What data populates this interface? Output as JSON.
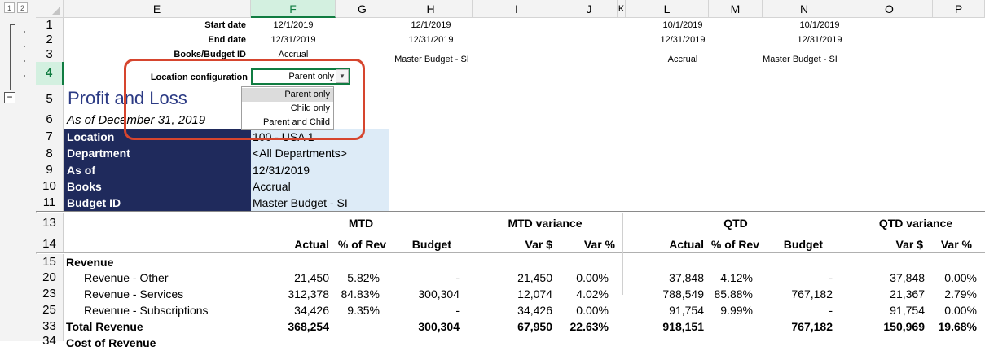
{
  "outline": {
    "level1": "1",
    "level2": "2",
    "collapse": "−"
  },
  "columns": [
    "E",
    "F",
    "G",
    "H",
    "I",
    "J",
    "K",
    "L",
    "M",
    "N",
    "O",
    "P"
  ],
  "rows": [
    "1",
    "2",
    "3",
    "4",
    "5",
    "6",
    "7",
    "8",
    "9",
    "10",
    "11",
    "13",
    "14",
    "15",
    "20",
    "23",
    "25",
    "33",
    "34"
  ],
  "params": {
    "start_label": "Start date",
    "end_label": "End date",
    "books_label": "Books/Budget ID",
    "locconf_label": "Location configuration",
    "f1": "12/1/2019",
    "h1": "12/1/2019",
    "l1": "10/1/2019",
    "n1": "10/1/2019",
    "f2": "12/31/2019",
    "h2": "12/31/2019",
    "l2": "12/31/2019",
    "n2": "12/31/2019",
    "f3": "Accrual",
    "h3": "Master Budget - SI",
    "l3": "Accrual",
    "n3": "Master Budget - SI"
  },
  "dropdown": {
    "value": "Parent only",
    "arrow": "▼",
    "options": [
      "Parent only",
      "Child only",
      "Parent and Child"
    ]
  },
  "report": {
    "title": "Profit and Loss",
    "subtitle": "As of December 31, 2019",
    "filters": [
      {
        "label": "Location",
        "value": "100 - USA 1"
      },
      {
        "label": "Department",
        "value": "<All Departments>"
      },
      {
        "label": "As of",
        "value": "12/31/2019"
      },
      {
        "label": "Books",
        "value": "Accrual"
      },
      {
        "label": "Budget ID",
        "value": "Master Budget - SI"
      }
    ]
  },
  "headers": {
    "mtd": "MTD",
    "mtd_var": "MTD variance",
    "qtd": "QTD",
    "qtd_var": "QTD variance",
    "actual": "Actual",
    "pct_rev": "% of Rev",
    "budget": "Budget",
    "var_d": "Var $",
    "var_p": "Var %"
  },
  "lines": [
    {
      "label": "Revenue",
      "indent": false,
      "bold": true,
      "vals": [
        "",
        "",
        "",
        "",
        "",
        "",
        "",
        "",
        "",
        ""
      ]
    },
    {
      "label": "Revenue - Other",
      "indent": true,
      "bold": false,
      "vals": [
        "21,450",
        "5.82%",
        "-",
        "21,450",
        "0.00%",
        "37,848",
        "4.12%",
        "-",
        "37,848",
        "0.00%"
      ]
    },
    {
      "label": "Revenue - Services",
      "indent": true,
      "bold": false,
      "vals": [
        "312,378",
        "84.83%",
        "300,304",
        "12,074",
        "4.02%",
        "788,549",
        "85.88%",
        "767,182",
        "21,367",
        "2.79%"
      ]
    },
    {
      "label": "Revenue - Subscriptions",
      "indent": true,
      "bold": false,
      "vals": [
        "34,426",
        "9.35%",
        "-",
        "34,426",
        "0.00%",
        "91,754",
        "9.99%",
        "-",
        "91,754",
        "0.00%"
      ]
    },
    {
      "label": "Total Revenue",
      "indent": false,
      "bold": true,
      "vals": [
        "368,254",
        "",
        "300,304",
        "67,950",
        "22.63%",
        "918,151",
        "",
        "767,182",
        "150,969",
        "19.68%"
      ]
    },
    {
      "label": "Cost of Revenue",
      "indent": false,
      "bold": true,
      "vals": [
        "",
        "",
        "",
        "",
        "",
        "",
        "",
        "",
        "",
        ""
      ]
    }
  ]
}
